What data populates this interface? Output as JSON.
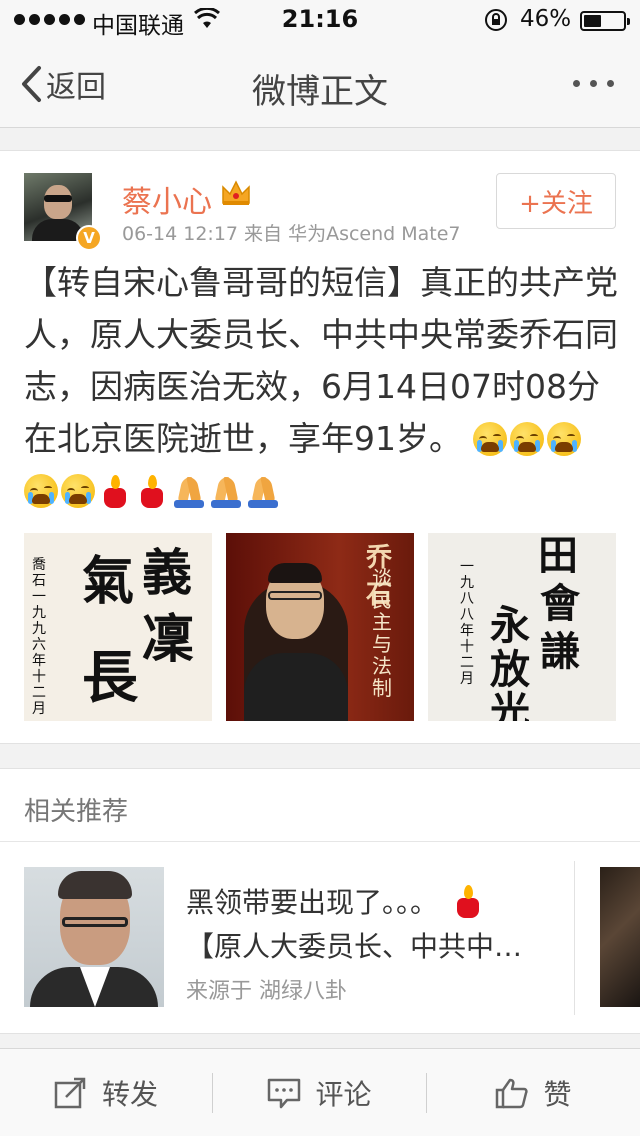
{
  "status_bar": {
    "carrier": "中国联通",
    "time": "21:16",
    "battery_percent": "46%",
    "battery_level": 0.46
  },
  "nav": {
    "back_label": "返回",
    "title": "微博正文"
  },
  "post": {
    "username": "蔡小心",
    "meta": "06-14 12:17  来自 华为Ascend Mate7",
    "follow_label": "+关注",
    "text": "【转自宋心鲁哥哥的短信】真正的共产党人，原人大委员长、中共中央常委乔石同志，因病医治无效，6月14日07时08分在北京医院逝世，享年91岁。",
    "emoji": [
      "cry",
      "cry",
      "cry",
      "cry",
      "cry",
      "candle",
      "candle",
      "pray",
      "pray",
      "pray"
    ],
    "photos": [
      {
        "name": "calligraphy-1",
        "text_a": "義",
        "text_b": "氣",
        "text_c": "凜",
        "text_d": "長",
        "side": "喬石 一九九六年十二月"
      },
      {
        "name": "book-cover",
        "title": "谈民主与法制",
        "author_mark": "乔石"
      },
      {
        "name": "calligraphy-2",
        "text_a": "田",
        "text_b": "會",
        "text_c": "永",
        "text_d": "放",
        "text_e": "光",
        "text_f": "謙",
        "side": "一九八八年十二月"
      }
    ]
  },
  "related": {
    "title": "相关推荐",
    "card": {
      "line1": "黑领带要出现了。。。",
      "line2": "【原人大委员长、中共中…",
      "source": "来源于  湖绿八卦"
    }
  },
  "toolbar": {
    "repost_label": "转发",
    "comment_label": "评论",
    "like_label": "赞"
  },
  "colors": {
    "accent": "#eb7350",
    "verified": "#f5a623"
  }
}
